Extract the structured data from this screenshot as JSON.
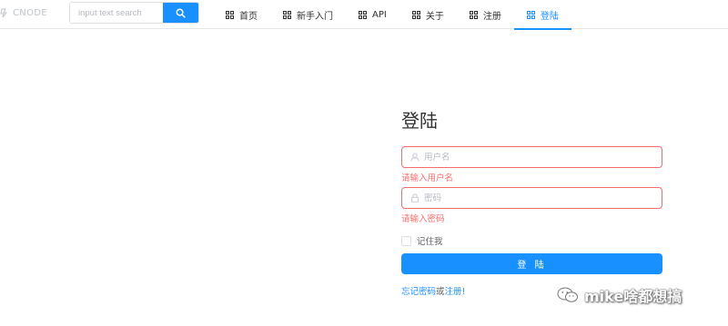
{
  "header": {
    "logo_text": "CNODE",
    "search": {
      "placeholder": "input text search"
    },
    "nav": [
      {
        "label": "首页",
        "active": false
      },
      {
        "label": "新手入门",
        "active": false
      },
      {
        "label": "API",
        "active": false
      },
      {
        "label": "关于",
        "active": false
      },
      {
        "label": "注册",
        "active": false
      },
      {
        "label": "登陆",
        "active": true
      }
    ]
  },
  "login": {
    "title": "登陆",
    "username": {
      "placeholder": "用户名",
      "error": "请输入用户名"
    },
    "password": {
      "placeholder": "密码",
      "error": "请输入密码"
    },
    "remember_label": "记住我",
    "submit_label": "登 陆",
    "forgot_label": "忘记密码",
    "or_text": "或",
    "register_label": "注册!"
  },
  "watermark": {
    "text": "mike啥都想搞"
  },
  "colors": {
    "primary": "#1890ff",
    "error": "#f56c6c"
  }
}
